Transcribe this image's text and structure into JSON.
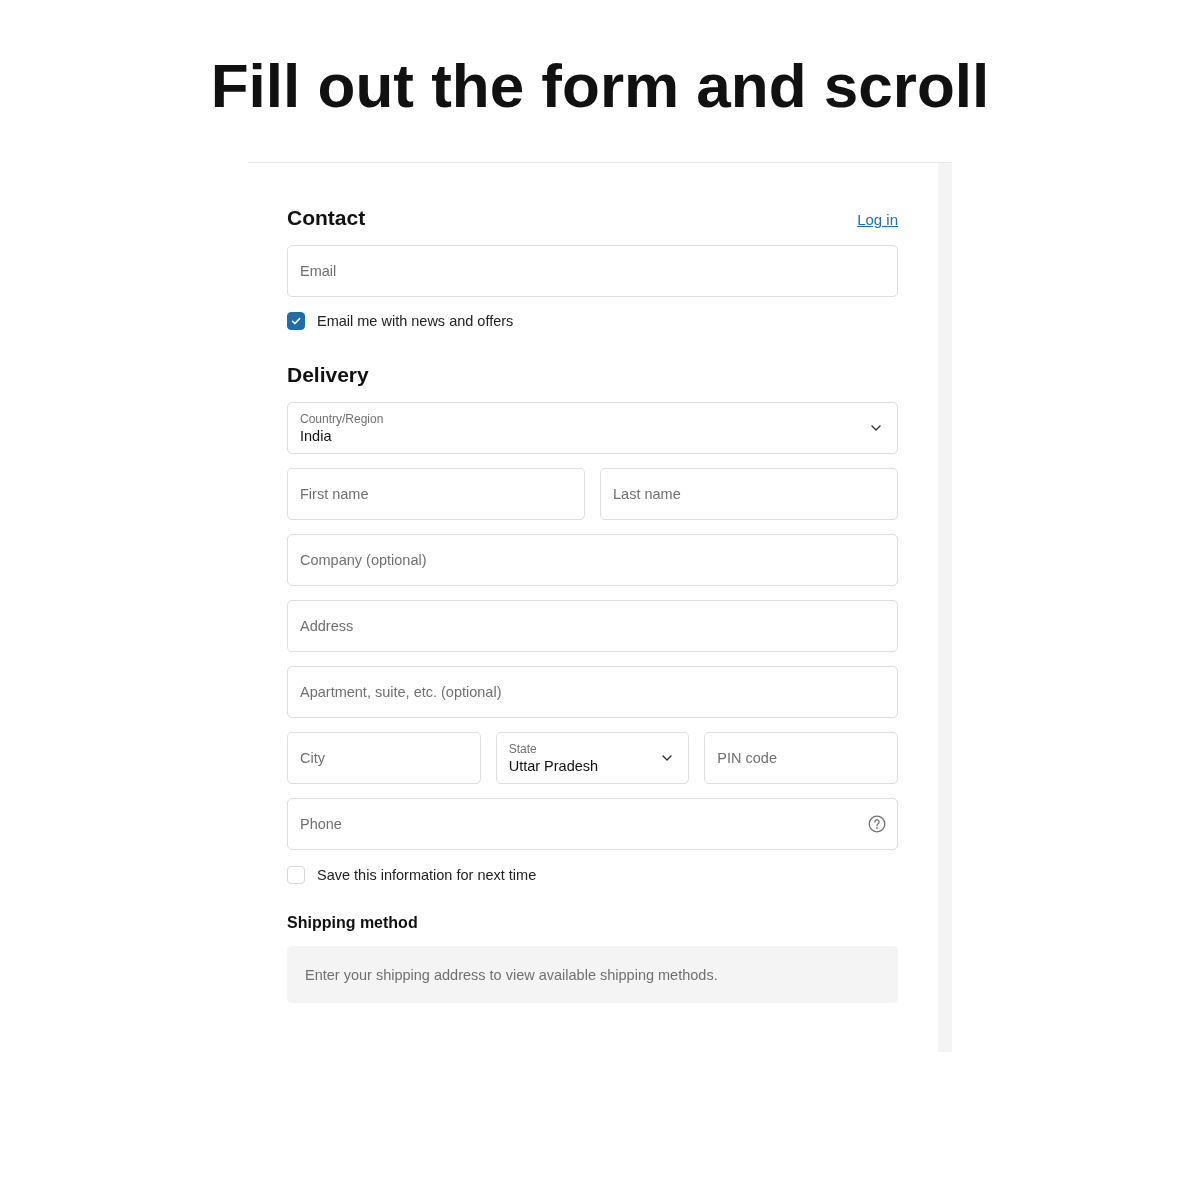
{
  "caption": "Fill out the form and scroll",
  "contact": {
    "heading": "Contact",
    "login_link": "Log in",
    "email": {
      "placeholder": "Email"
    },
    "newsletter": {
      "label": "Email me with news and offers",
      "checked": true
    }
  },
  "delivery": {
    "heading": "Delivery",
    "rows": [
      [
        {
          "kind": "select",
          "label": "Country/Region",
          "value": "India"
        }
      ],
      [
        {
          "kind": "text",
          "placeholder": "First name"
        },
        {
          "kind": "text",
          "placeholder": "Last name"
        }
      ],
      [
        {
          "kind": "text",
          "placeholder": "Company (optional)"
        }
      ],
      [
        {
          "kind": "text",
          "placeholder": "Address"
        }
      ],
      [
        {
          "kind": "text",
          "placeholder": "Apartment, suite, etc. (optional)"
        }
      ],
      [
        {
          "kind": "text",
          "placeholder": "City"
        },
        {
          "kind": "select",
          "label": "State",
          "value": "Uttar Pradesh"
        },
        {
          "kind": "text",
          "placeholder": "PIN code"
        }
      ],
      [
        {
          "kind": "help",
          "placeholder": "Phone"
        }
      ]
    ],
    "save_info": {
      "label": "Save this information for next time",
      "checked": false
    }
  },
  "shipping": {
    "heading": "Shipping method",
    "notice": "Enter your shipping address to view available shipping methods."
  }
}
